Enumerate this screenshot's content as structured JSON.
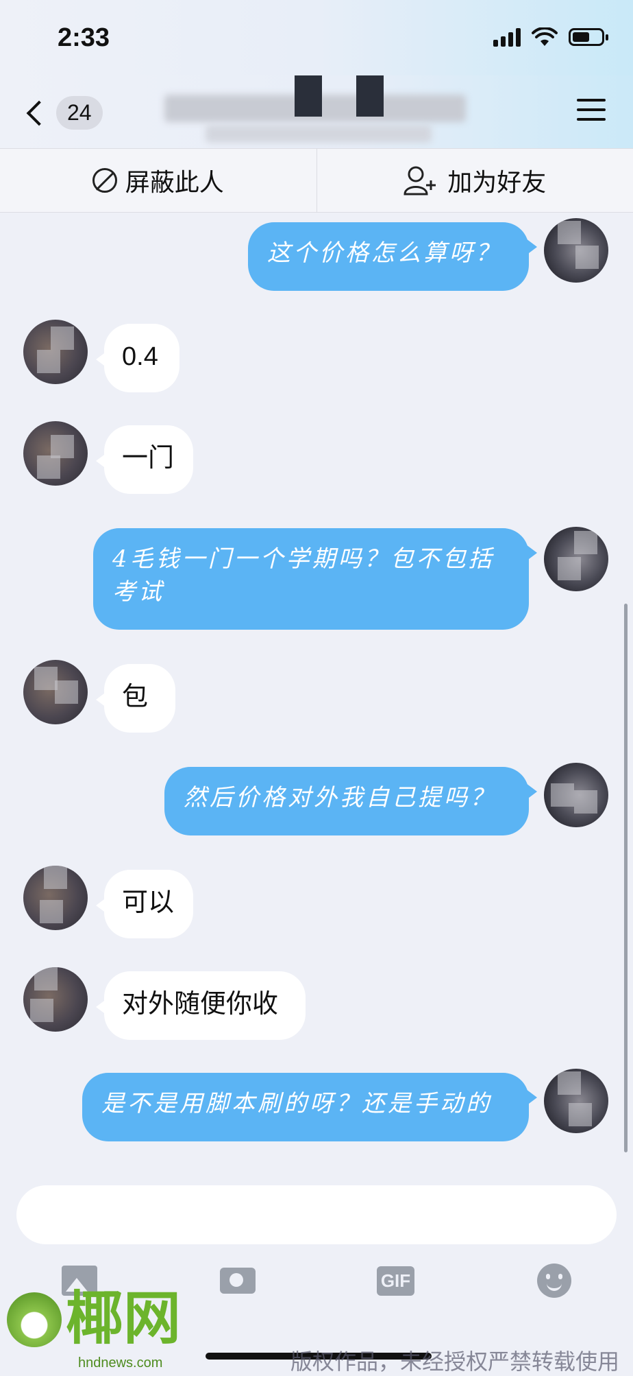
{
  "status_bar": {
    "time": "2:33"
  },
  "nav": {
    "unread_count": "24"
  },
  "actions": {
    "block_label": "屏蔽此人",
    "add_friend_label": "加为好友"
  },
  "messages": [
    {
      "side": "out",
      "text": "这个价格怎么算呀？"
    },
    {
      "side": "in",
      "text": "0.4"
    },
    {
      "side": "in",
      "text": "一门"
    },
    {
      "side": "out",
      "text": "4毛钱一门一个学期吗？包不包括考试"
    },
    {
      "side": "in",
      "text": "包"
    },
    {
      "side": "out",
      "text": "然后价格对外我自己提吗？"
    },
    {
      "side": "in",
      "text": "可以"
    },
    {
      "side": "in",
      "text": "对外随便你收"
    },
    {
      "side": "out",
      "text": "是不是用脚本刷的呀？还是手动的"
    }
  ],
  "input": {
    "value": "",
    "placeholder": ""
  },
  "toolbar": {
    "gif_label": "GIF"
  },
  "watermark": {
    "brand": "椰网",
    "domain": "hndnews.com",
    "copyright": "版权作品，未经授权严禁转载使用"
  }
}
